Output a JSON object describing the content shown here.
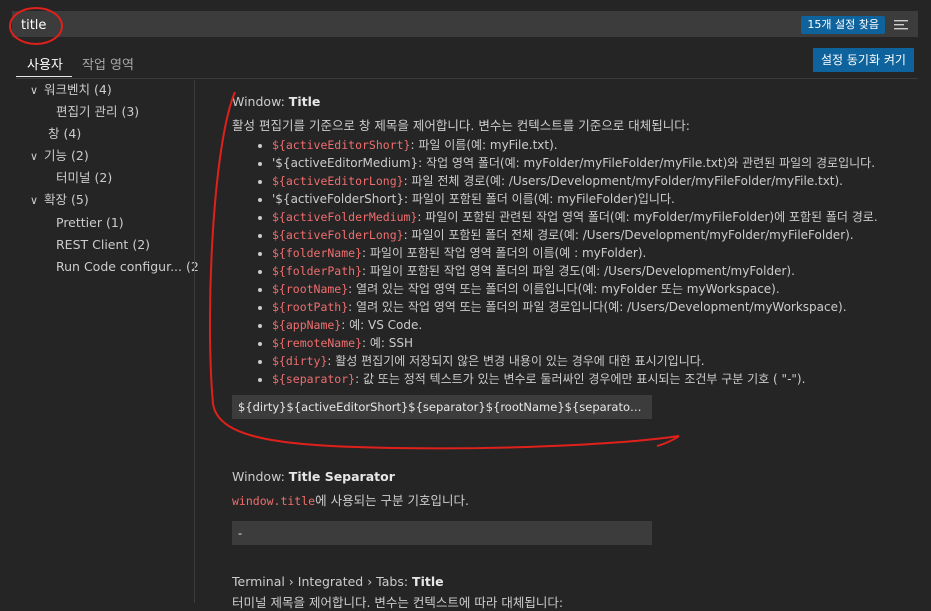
{
  "search": {
    "value": "title",
    "found_badge": "15개 설정 찾음",
    "filter_icon": "filter-list-icon"
  },
  "tabs": [
    {
      "label": "사용자",
      "active": true
    },
    {
      "label": "작업 영역",
      "active": false
    }
  ],
  "sync_button": "설정 동기화 켜기",
  "tree": [
    {
      "label": "워크벤치",
      "count": "(4)",
      "expanded": true,
      "level": 1
    },
    {
      "label": "편집기 관리",
      "count": "(3)",
      "level": 2
    },
    {
      "label": "창",
      "count": "(4)",
      "level": 1
    },
    {
      "label": "기능",
      "count": "(2)",
      "expanded": true,
      "level": 1
    },
    {
      "label": "터미널",
      "count": "(2)",
      "level": 2
    },
    {
      "label": "확장",
      "count": "(5)",
      "expanded": true,
      "level": 1
    },
    {
      "label": "Prettier",
      "count": "(1)",
      "level": 2
    },
    {
      "label": "REST Client",
      "count": "(2)",
      "level": 2
    },
    {
      "label": "Run Code configur...",
      "count": "(2",
      "level": 2
    }
  ],
  "settings": {
    "title_setting": {
      "category": "Window: ",
      "name": "Title",
      "description": "활성 편집기를 기준으로 창 제목을 제어합니다. 변수는 컨텍스트를 기준으로 대체됩니다:",
      "bullets": [
        {
          "code": "${activeEditorShort}",
          "text": ": 파일 이름(예: myFile.txt)."
        },
        {
          "code": "",
          "text": "'${activeEditorMedium}: 작업 영역 폴더(예: myFolder/myFileFolder/myFile.txt)와 관련된 파일의 경로입니다."
        },
        {
          "code": "${activeEditorLong}",
          "text": ": 파일 전체 경로(예: /Users/Development/myFolder/myFileFolder/myFile.txt)."
        },
        {
          "code": "",
          "text": "'${activeFolderShort}: 파일이 포함된 폴더 이름(예: myFileFolder)입니다."
        },
        {
          "code": "${activeFolderMedium}",
          "text": ": 파일이 포함된 관련된 작업 영역 폴더(예: myFolder/myFileFolder)에 포함된 폴더 경로."
        },
        {
          "code": "${activeFolderLong}",
          "text": ": 파일이 포함된 폴더 전체 경로(예: /Users/Development/myFolder/myFileFolder)."
        },
        {
          "code": "${folderName}",
          "text": ": 파일이 포함된 작업 영역 폴더의 이름(예 : myFolder)."
        },
        {
          "code": "${folderPath}",
          "text": ": 파일이 포함된 작업 영역 폴더의 파일 경도(예: /Users/Development/myFolder)."
        },
        {
          "code": "${rootName}",
          "text": ": 열려 있는 작업 영역 또는 폴더의 이름입니다(예: myFolder 또는 myWorkspace)."
        },
        {
          "code": "${rootPath}",
          "text": ": 열려 있는 작업 영역 또는 폴더의 파일 경로입니다(예: /Users/Development/myWorkspace)."
        },
        {
          "code": "${appName}",
          "text": ": 예: VS Code."
        },
        {
          "code": "${remoteName}",
          "text": ": 예: SSH"
        },
        {
          "code": "${dirty}",
          "text": ": 활성 편집기에 저장되지 않은 변경 내용이 있는 경우에 대한 표시기입니다."
        },
        {
          "code": "${separator}",
          "text": ": 값 또는 정적 텍스트가 있는 변수로 둘러싸인 경우에만 표시되는 조건부 구분 기호 ( \"-\")."
        }
      ],
      "value": "${dirty}${activeEditorShort}${separator}${rootName}${separator}${app..."
    },
    "separator_setting": {
      "category": "Window: ",
      "name": "Title Separator",
      "desc_code": "window.title",
      "desc_text": "에 사용되는 구분 기호입니다.",
      "value": " - "
    },
    "terminal_setting": {
      "category": "Terminal › Integrated › Tabs: ",
      "name": "Title",
      "description": "터미널 제목을 제어합니다. 변수는 컨텍스트에 따라 대체됩니다:"
    }
  },
  "colors": {
    "background": "#252526",
    "accent": "#0e639c",
    "code": "#ef6e6e",
    "annotation": "#e0211b"
  }
}
